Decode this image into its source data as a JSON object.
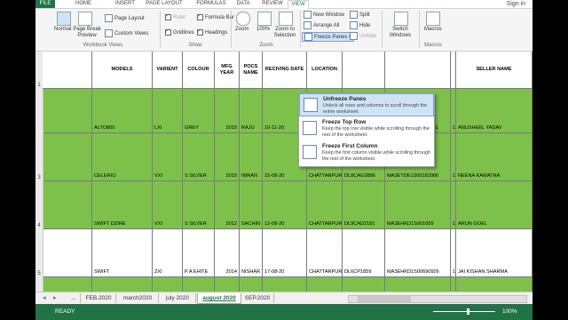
{
  "ribbon_tabs": [
    "FILE",
    "HOME",
    "INSERT",
    "PAGE LAYOUT",
    "FORMULAS",
    "DATA",
    "REVIEW",
    "VIEW"
  ],
  "signin": "Sign in",
  "ribbon": {
    "normal": "Normal",
    "page_break_preview": "Page Break Preview",
    "page_layout": "Page Layout",
    "custom_views": "Custom Views",
    "workbook_views_group": "Workbook Views",
    "ruler": "Ruler",
    "formula_bar": "Formula Bar",
    "gridlines": "Gridlines",
    "headings": "Headings",
    "show_group": "Show",
    "zoom": "Zoom",
    "zoom_100": "100%",
    "zoom_to_selection": "Zoom to Selection",
    "zoom_group": "Zoom",
    "new_window": "New Window",
    "arrange_all": "Arrange All",
    "freeze_panes": "Freeze Panes",
    "split": "Split",
    "hide": "Hide",
    "unhide": "Unhide",
    "switch_windows": "Switch Windows",
    "macros": "Macros",
    "macros_group": "Macros"
  },
  "dropdown": [
    {
      "title": "Unfreeze Panes",
      "desc": "Unlock all rows and columns to scroll through the entire worksheet."
    },
    {
      "title": "Freeze Top Row",
      "desc": "Keep the top row visible while scrolling through the rest of the worksheet."
    },
    {
      "title": "Freeze First Column",
      "desc": "Keep the first column visible while scrolling through the rest of the worksheet."
    }
  ],
  "headers": [
    "",
    "MODELS",
    "VARIENT",
    "COLOUR",
    "MFG YEAR",
    "POCS NAME",
    "RECIVING DATE",
    "LOCATION",
    "",
    "",
    "",
    "SELLER NAME"
  ],
  "row_numbers": [
    "1",
    "",
    "3",
    "4",
    "5",
    "6"
  ],
  "rows": [
    [
      "",
      "",
      "",
      "",
      "",
      "",
      "",
      "",
      "",
      "",
      ""
    ],
    [
      "ALTO800",
      "LXI",
      "GREY",
      "2015",
      "RAJU",
      "10-11-20",
      "CHATTARPUR",
      "DL9CAK5316",
      "MA3EUA61S00609081",
      "1",
      "ANUSHEEL YADAV"
    ],
    [
      "CELERIO",
      "VXI",
      "S SILVER",
      "2015",
      "IMRAN",
      "15-08-20",
      "CHATTARPUR",
      "DL8CAG3886",
      "MA3ETDE1S00182986",
      "1",
      "NEENA KAWATRA"
    ],
    [
      "SWIFT DZIRE",
      "VXI",
      "S SILVER",
      "2012",
      "SACHIN",
      "12-08-20",
      "CHATTARPUR",
      "DL9CAD2181",
      "MA3EHKD1S001659",
      "1",
      "ARUN GOEL"
    ],
    [
      "SWIFT",
      "ZXI",
      "P A EHITE",
      "2014",
      "NISHAR",
      "17-08-20",
      "CHATTARPUR",
      "DL6CP1859",
      "MA3EHKD1S00690926",
      "1",
      "JAI KISHAN SHARMA"
    ],
    [
      "",
      "",
      "",
      "",
      "",
      "",
      "",
      "",
      "",
      "",
      ""
    ]
  ],
  "sheet_tabs": [
    "...",
    "FEB.2020",
    "march2020",
    "july 2020",
    "august 2020",
    "SEP.2020"
  ],
  "active_sheet": "august 2020",
  "status": {
    "ready": "READY",
    "zoom": "100%"
  }
}
